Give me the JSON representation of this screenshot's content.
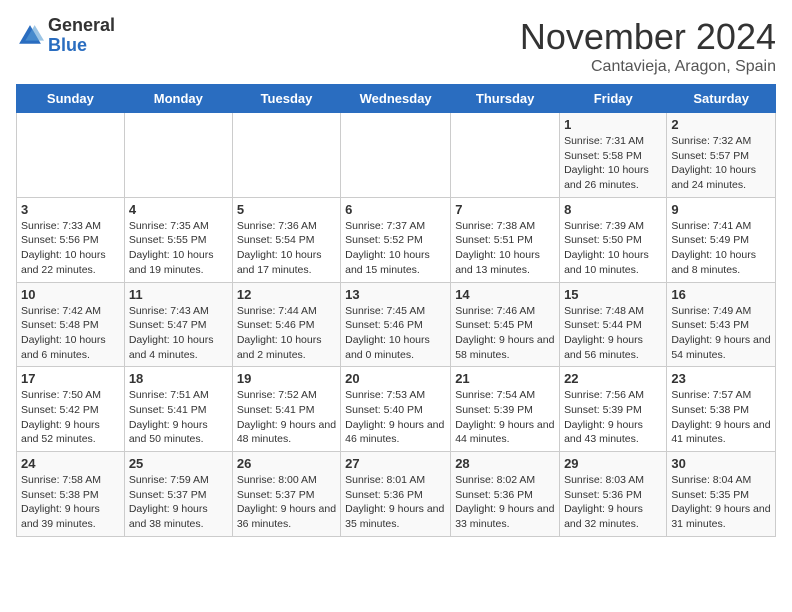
{
  "header": {
    "logo_general": "General",
    "logo_blue": "Blue",
    "month_title": "November 2024",
    "location": "Cantavieja, Aragon, Spain"
  },
  "days_of_week": [
    "Sunday",
    "Monday",
    "Tuesday",
    "Wednesday",
    "Thursday",
    "Friday",
    "Saturday"
  ],
  "weeks": [
    [
      {
        "day": "",
        "info": ""
      },
      {
        "day": "",
        "info": ""
      },
      {
        "day": "",
        "info": ""
      },
      {
        "day": "",
        "info": ""
      },
      {
        "day": "",
        "info": ""
      },
      {
        "day": "1",
        "info": "Sunrise: 7:31 AM\nSunset: 5:58 PM\nDaylight: 10 hours and 26 minutes."
      },
      {
        "day": "2",
        "info": "Sunrise: 7:32 AM\nSunset: 5:57 PM\nDaylight: 10 hours and 24 minutes."
      }
    ],
    [
      {
        "day": "3",
        "info": "Sunrise: 7:33 AM\nSunset: 5:56 PM\nDaylight: 10 hours and 22 minutes."
      },
      {
        "day": "4",
        "info": "Sunrise: 7:35 AM\nSunset: 5:55 PM\nDaylight: 10 hours and 19 minutes."
      },
      {
        "day": "5",
        "info": "Sunrise: 7:36 AM\nSunset: 5:54 PM\nDaylight: 10 hours and 17 minutes."
      },
      {
        "day": "6",
        "info": "Sunrise: 7:37 AM\nSunset: 5:52 PM\nDaylight: 10 hours and 15 minutes."
      },
      {
        "day": "7",
        "info": "Sunrise: 7:38 AM\nSunset: 5:51 PM\nDaylight: 10 hours and 13 minutes."
      },
      {
        "day": "8",
        "info": "Sunrise: 7:39 AM\nSunset: 5:50 PM\nDaylight: 10 hours and 10 minutes."
      },
      {
        "day": "9",
        "info": "Sunrise: 7:41 AM\nSunset: 5:49 PM\nDaylight: 10 hours and 8 minutes."
      }
    ],
    [
      {
        "day": "10",
        "info": "Sunrise: 7:42 AM\nSunset: 5:48 PM\nDaylight: 10 hours and 6 minutes."
      },
      {
        "day": "11",
        "info": "Sunrise: 7:43 AM\nSunset: 5:47 PM\nDaylight: 10 hours and 4 minutes."
      },
      {
        "day": "12",
        "info": "Sunrise: 7:44 AM\nSunset: 5:46 PM\nDaylight: 10 hours and 2 minutes."
      },
      {
        "day": "13",
        "info": "Sunrise: 7:45 AM\nSunset: 5:46 PM\nDaylight: 10 hours and 0 minutes."
      },
      {
        "day": "14",
        "info": "Sunrise: 7:46 AM\nSunset: 5:45 PM\nDaylight: 9 hours and 58 minutes."
      },
      {
        "day": "15",
        "info": "Sunrise: 7:48 AM\nSunset: 5:44 PM\nDaylight: 9 hours and 56 minutes."
      },
      {
        "day": "16",
        "info": "Sunrise: 7:49 AM\nSunset: 5:43 PM\nDaylight: 9 hours and 54 minutes."
      }
    ],
    [
      {
        "day": "17",
        "info": "Sunrise: 7:50 AM\nSunset: 5:42 PM\nDaylight: 9 hours and 52 minutes."
      },
      {
        "day": "18",
        "info": "Sunrise: 7:51 AM\nSunset: 5:41 PM\nDaylight: 9 hours and 50 minutes."
      },
      {
        "day": "19",
        "info": "Sunrise: 7:52 AM\nSunset: 5:41 PM\nDaylight: 9 hours and 48 minutes."
      },
      {
        "day": "20",
        "info": "Sunrise: 7:53 AM\nSunset: 5:40 PM\nDaylight: 9 hours and 46 minutes."
      },
      {
        "day": "21",
        "info": "Sunrise: 7:54 AM\nSunset: 5:39 PM\nDaylight: 9 hours and 44 minutes."
      },
      {
        "day": "22",
        "info": "Sunrise: 7:56 AM\nSunset: 5:39 PM\nDaylight: 9 hours and 43 minutes."
      },
      {
        "day": "23",
        "info": "Sunrise: 7:57 AM\nSunset: 5:38 PM\nDaylight: 9 hours and 41 minutes."
      }
    ],
    [
      {
        "day": "24",
        "info": "Sunrise: 7:58 AM\nSunset: 5:38 PM\nDaylight: 9 hours and 39 minutes."
      },
      {
        "day": "25",
        "info": "Sunrise: 7:59 AM\nSunset: 5:37 PM\nDaylight: 9 hours and 38 minutes."
      },
      {
        "day": "26",
        "info": "Sunrise: 8:00 AM\nSunset: 5:37 PM\nDaylight: 9 hours and 36 minutes."
      },
      {
        "day": "27",
        "info": "Sunrise: 8:01 AM\nSunset: 5:36 PM\nDaylight: 9 hours and 35 minutes."
      },
      {
        "day": "28",
        "info": "Sunrise: 8:02 AM\nSunset: 5:36 PM\nDaylight: 9 hours and 33 minutes."
      },
      {
        "day": "29",
        "info": "Sunrise: 8:03 AM\nSunset: 5:36 PM\nDaylight: 9 hours and 32 minutes."
      },
      {
        "day": "30",
        "info": "Sunrise: 8:04 AM\nSunset: 5:35 PM\nDaylight: 9 hours and 31 minutes."
      }
    ]
  ]
}
